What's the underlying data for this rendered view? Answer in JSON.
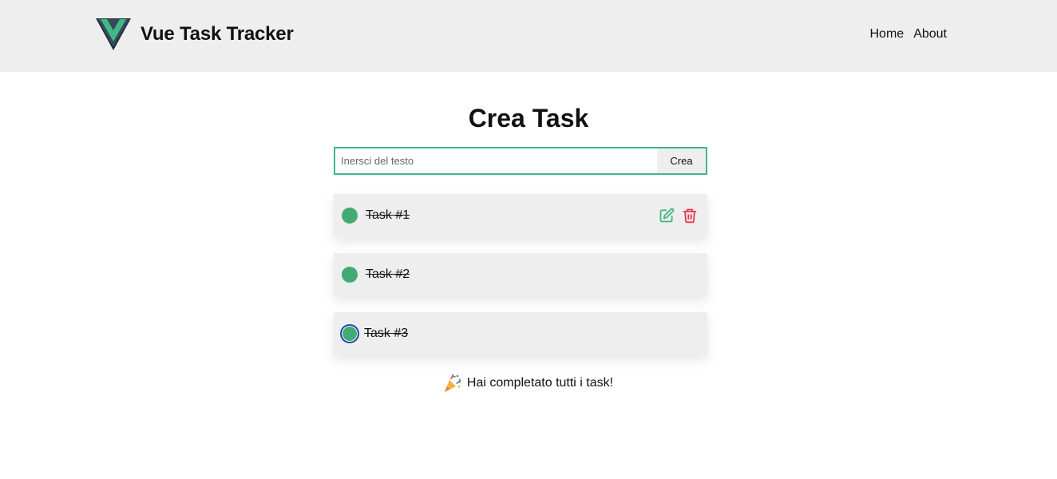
{
  "header": {
    "app_title": "Vue Task Tracker",
    "logo_icon": "vue-logo-icon",
    "nav": [
      {
        "label": "Home"
      },
      {
        "label": "About"
      }
    ]
  },
  "main": {
    "title": "Crea Task",
    "form": {
      "input_value": "",
      "input_placeholder": "Inersci del testo",
      "submit_label": "Crea"
    },
    "tasks": [
      {
        "label": "Task #1",
        "completed": true,
        "actions": [
          "edit-icon",
          "trash-icon"
        ]
      },
      {
        "label": "Task #2",
        "completed": true
      },
      {
        "label": "Task #3",
        "completed": true
      }
    ],
    "completion_message": "Hai completato tutti i task!",
    "completion_icon": "party-popper-icon"
  },
  "colors": {
    "accent": "#42b883",
    "check": "#42ab74",
    "danger": "#e23b4a",
    "header_bg": "#eeeeee",
    "card_bg": "#eeeeee"
  }
}
